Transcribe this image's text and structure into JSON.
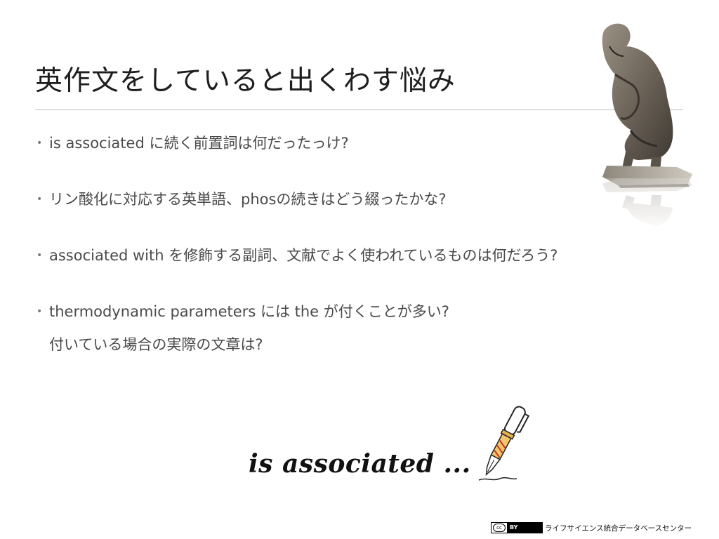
{
  "slide": {
    "title": "英作文をしていると出くわす悩み",
    "bullets": [
      {
        "lines": [
          "is associated に続く前置詞は何だったっけ?"
        ]
      },
      {
        "lines": [
          "リン酸化に対応する英単語、phosの続きはどう綴ったかな?"
        ]
      },
      {
        "lines": [
          "associated with を修飾する副詞、文献でよく使われているものは何だろう?"
        ]
      },
      {
        "lines": [
          "thermodynamic parameters には the が付くことが多い?",
          "付いている場合の実際の文章は?"
        ]
      }
    ],
    "bullet_symbol": "•",
    "handwriting": "is  associated  ...",
    "illustrations": {
      "thinker": "thinker-statue-icon",
      "pen": "fountain-pen-icon"
    }
  },
  "footer": {
    "license_cc": "cc",
    "license_by": "BY",
    "organization": "ライフサイエンス統合データベースセンター"
  },
  "colors": {
    "title": "#1e1e1e",
    "body_text": "#4a4a4a",
    "rule": "#bdbdbd",
    "statue": "#6e655a"
  }
}
